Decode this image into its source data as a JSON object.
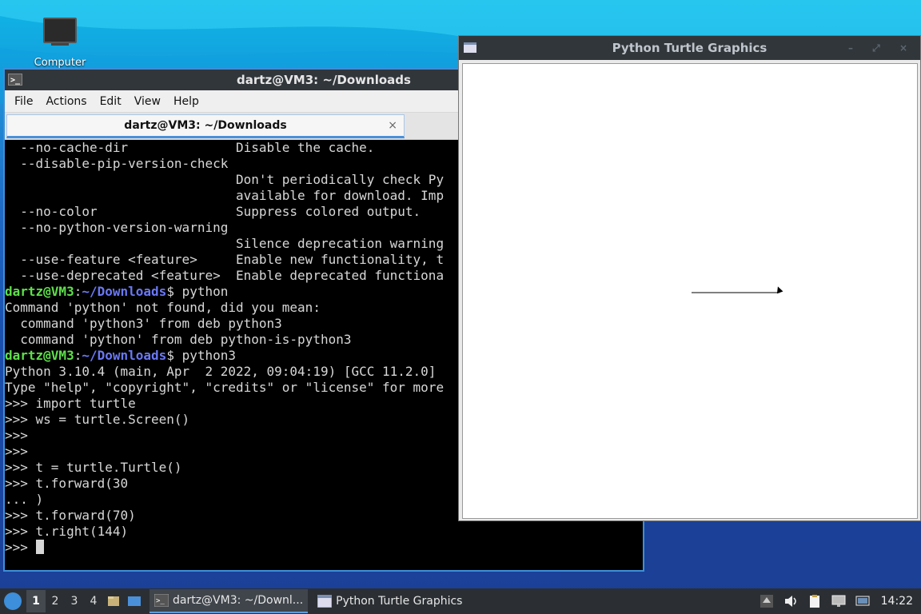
{
  "desktop": {
    "icons": [
      {
        "label": "Computer",
        "icon": "computer-icon"
      }
    ]
  },
  "terminal": {
    "title": "dartz@VM3: ~/Downloads",
    "menu": [
      "File",
      "Actions",
      "Edit",
      "View",
      "Help"
    ],
    "tab_label": "dartz@VM3: ~/Downloads",
    "tab_close": "×",
    "lines": [
      "  --no-cache-dir              Disable the cache.",
      "  --disable-pip-version-check",
      "                              Don't periodically check Py",
      "                              available for download. Imp",
      "  --no-color                  Suppress colored output.",
      "  --no-python-version-warning",
      "                              Silence deprecation warning",
      "  --use-feature <feature>     Enable new functionality, t",
      "  --use-deprecated <feature>  Enable deprecated functiona",
      "",
      "Command 'python' not found, did you mean:",
      "  command 'python3' from deb python3",
      "  command 'python' from deb python-is-python3",
      "",
      "Python 3.10.4 (main, Apr  2 2022, 09:04:19) [GCC 11.2.0]",
      "Type \"help\", \"copyright\", \"credits\" or \"license\" for more",
      ">>> import turtle",
      ">>> ws = turtle.Screen()",
      ">>>",
      ">>>",
      ">>> t = turtle.Turtle()",
      ">>> t.forward(30",
      "... )",
      ">>> t.forward(70)",
      ">>> t.right(144)",
      ">>> "
    ],
    "prompt_user": "dartz@VM3",
    "prompt_sep": ":",
    "prompt_path": "~/Downloads",
    "prompt_dollar": "$ ",
    "cmd_1": "python",
    "cmd_2": "python3"
  },
  "turtle_window": {
    "title": "Python Turtle Graphics",
    "controls": "– ⤢ ×"
  },
  "taskbar": {
    "workspaces": [
      "1",
      "2",
      "3",
      "4"
    ],
    "active_workspace": "1",
    "tasks": [
      {
        "label": "dartz@VM3: ~/Downl...",
        "icon": "terminal-icon",
        "active": true
      },
      {
        "label": "Python Turtle Graphics",
        "icon": "window-icon",
        "active": false
      }
    ],
    "clock": "14:22"
  },
  "colors": {
    "prompt_user": "#5ee04a",
    "prompt_path": "#6a78f5",
    "terminal_bg": "#000000",
    "titlebar": "#31363b",
    "accent": "#4a90d9"
  }
}
